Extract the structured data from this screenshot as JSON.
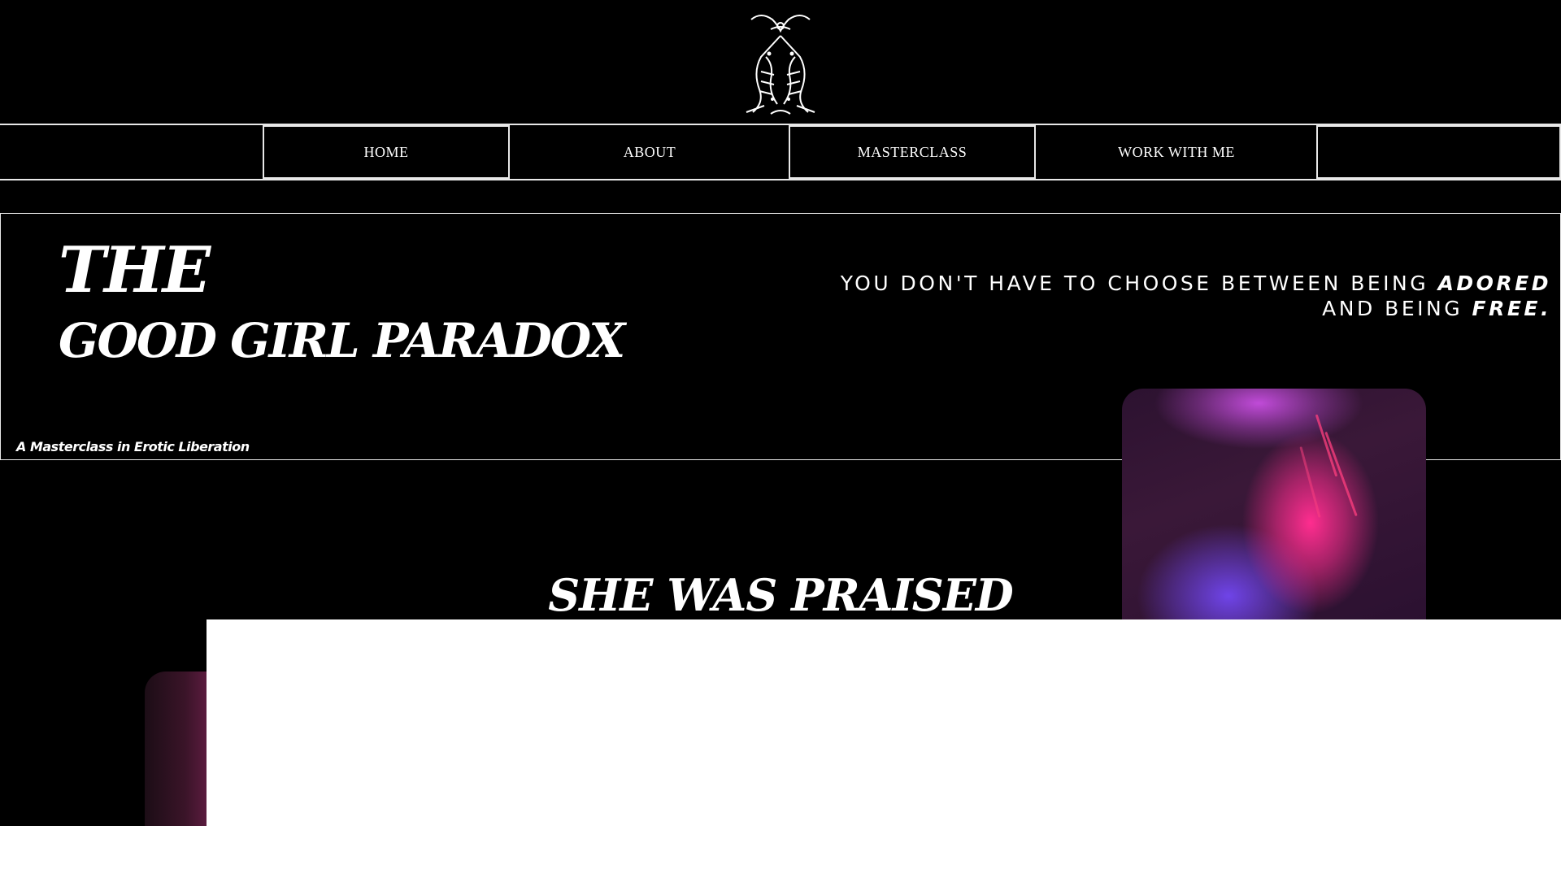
{
  "header": {
    "logo_icon": "twin-tiger-crest-icon"
  },
  "nav": {
    "items": [
      {
        "label": "HOME"
      },
      {
        "label": "ABOUT"
      },
      {
        "label": "MASTERCLASS"
      },
      {
        "label": "WORK WITH ME"
      }
    ]
  },
  "hero": {
    "title_line1": "THE",
    "title_line2": "GOOD GIRL PARADOX",
    "tagline_part1": "YOU DON'T HAVE TO CHOOSE BETWEEN BEING ",
    "tagline_emphasis1": "ADORED",
    "tagline_part2": "AND BEING ",
    "tagline_emphasis2": "FREE.",
    "subtitle": "A Masterclass in Erotic Liberation"
  },
  "section": {
    "heading": "SHE WAS PRAISED"
  },
  "colors": {
    "background": "#000000",
    "text": "#ffffff",
    "rule": "#e8e8e8",
    "accent_pink": "#ff2d8f",
    "accent_violet": "#6f44e8"
  }
}
